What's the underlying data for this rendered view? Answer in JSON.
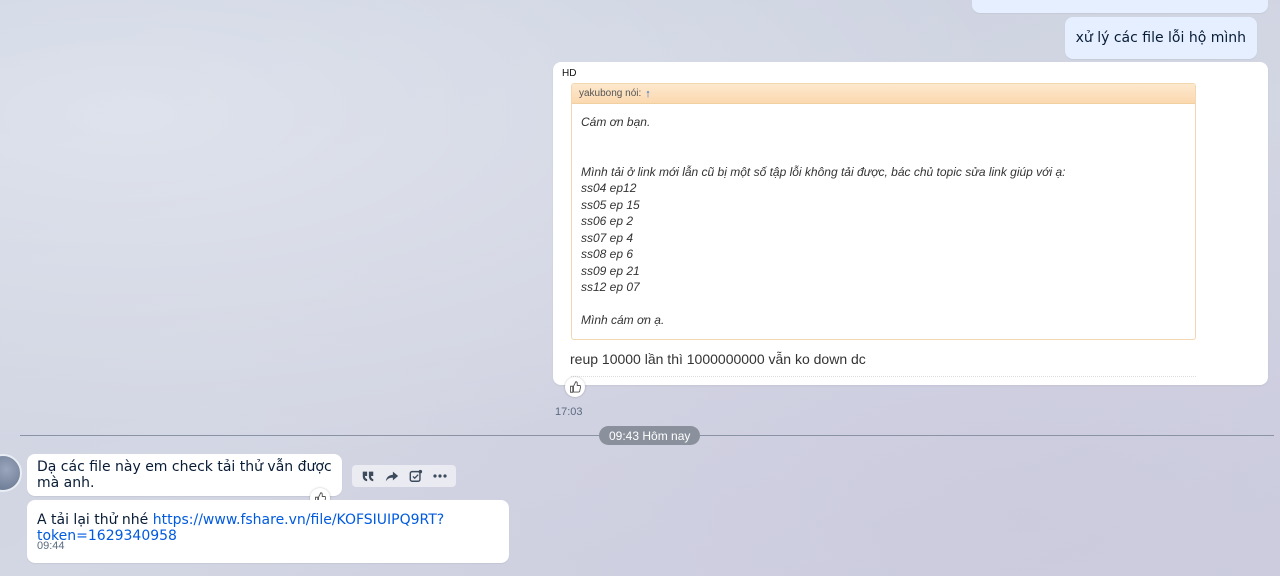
{
  "messages": {
    "mine": {
      "text": "xử lý các file lỗi hộ mình"
    },
    "card": {
      "sender": "HD",
      "quote_header": "yakubong nói:",
      "quote_arrow": "↑",
      "quote_lines": [
        "Cám ơn bạn.",
        "",
        "",
        "Mình tải ở link mới lẫn cũ bị một số tập lỗi không tải được, bác chủ topic sửa link giúp với ạ:",
        "ss04 ep12",
        "ss05 ep 15",
        "ss06 ep 2",
        "ss07 ep 4",
        "ss08 ep 6",
        "ss09 ep 21",
        "ss12 ep 07",
        "",
        "Mình cám ơn ạ."
      ],
      "reply_text": "reup 10000 lần thì 1000000000 vẫn ko down dc",
      "time": "17:03"
    },
    "date_divider": "09:43 Hôm nay",
    "incoming_1": {
      "text": "Dạ các file này em check tải thử vẫn được mà anh."
    },
    "incoming_2": {
      "prefix": "A tải lại thử nhé ",
      "link": "https://www.fshare.vn/file/KOFSIUIPQ9RT?token=1629340958",
      "time": "09:44"
    }
  },
  "toolbar": {
    "icons": [
      "quote-icon",
      "forward-icon",
      "task-icon",
      "more-icon"
    ]
  }
}
